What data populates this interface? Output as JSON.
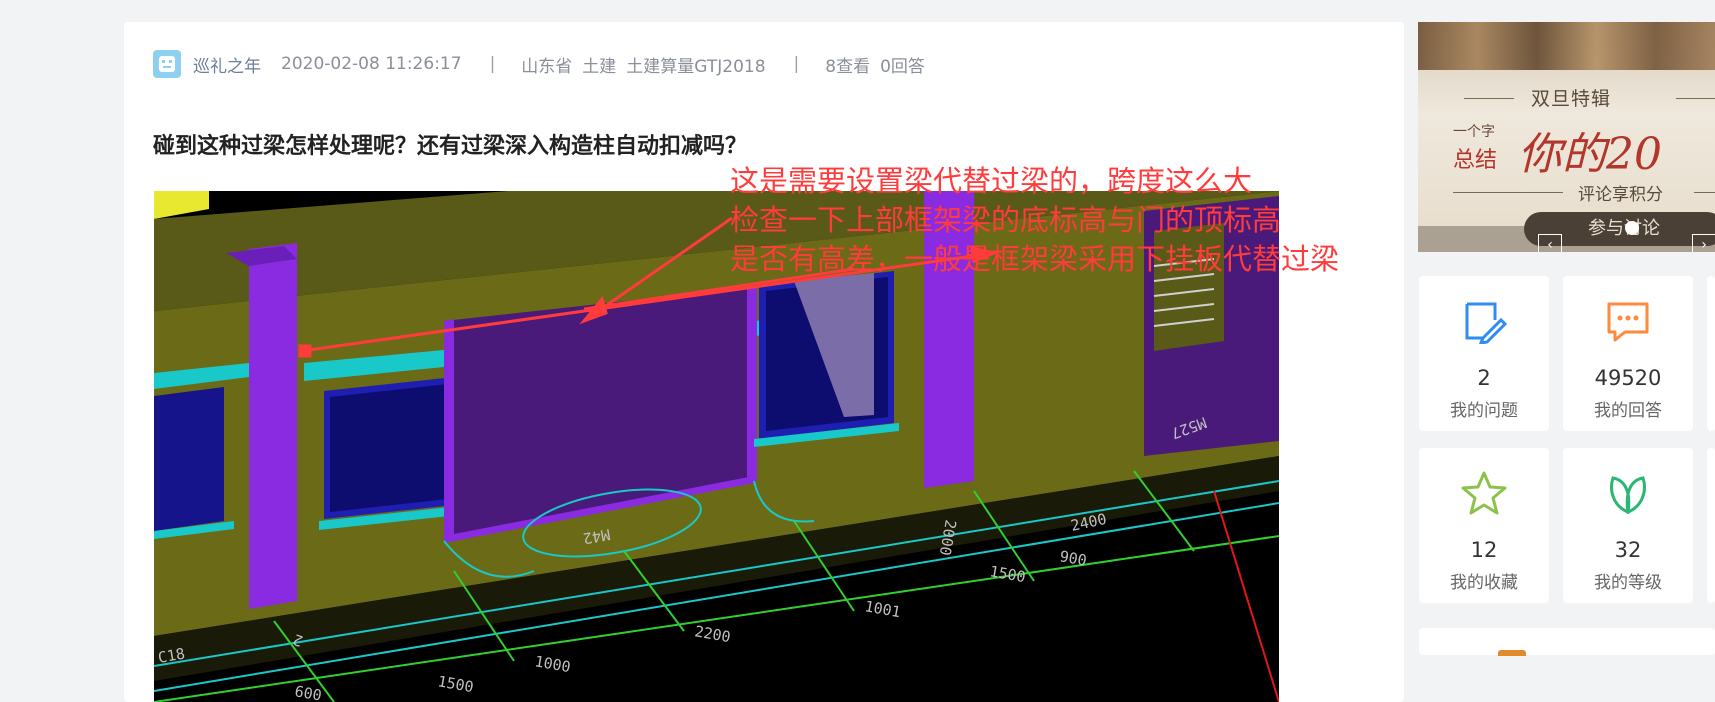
{
  "question": {
    "author": "巡礼之年",
    "datetime": "2020-02-08 11:26:17",
    "separator": "|",
    "region": "山东省",
    "category": "土建",
    "software": "土建算量GTJ2018",
    "views": "8查看",
    "answers": "0回答",
    "title": "碰到这种过梁怎样处理呢？还有过梁深入构造柱自动扣减吗？"
  },
  "image_annotation": {
    "lines": [
      "这是需要设置梁代替过梁的，跨度这么大",
      "检查一下上部框架梁的底标高与门的顶标高",
      "是否有高差，一般是框架梁采用下挂板代替过梁"
    ],
    "color": "#ff3b3b"
  },
  "cad_labels": {
    "door1": "M42",
    "door2": "M527",
    "dim1": "2000",
    "dim2": "2400",
    "dim3": "1500",
    "dim4": "900",
    "dim5": "1001",
    "dim6": "2200",
    "dim7": "1000",
    "dim8": "1500",
    "dim9": "600",
    "axis": "2",
    "edge": "C18"
  },
  "banner": {
    "title": "双旦特辑",
    "small1": "一个字",
    "small2": "总结",
    "big": "你的20",
    "subtitle": "评论享积分",
    "cta": "参与讨论",
    "prev": "‹",
    "next": "›"
  },
  "stats": [
    {
      "value": "2",
      "label": "我的问题",
      "icon": "edit-note-icon",
      "color": "#2f8cf0"
    },
    {
      "value": "49520",
      "label": "我的回答",
      "icon": "chat-bubble-icon",
      "color": "#ff8a3d"
    },
    {
      "value": "12",
      "label": "我的收藏",
      "icon": "star-icon",
      "color": "#8bc34a"
    },
    {
      "value": "32",
      "label": "我的等级",
      "icon": "leaf-icon",
      "color": "#2bb673"
    }
  ],
  "colors": {
    "page_bg": "#f2f3f5",
    "author": "#6e7e9a",
    "meta": "#8a8f99"
  }
}
